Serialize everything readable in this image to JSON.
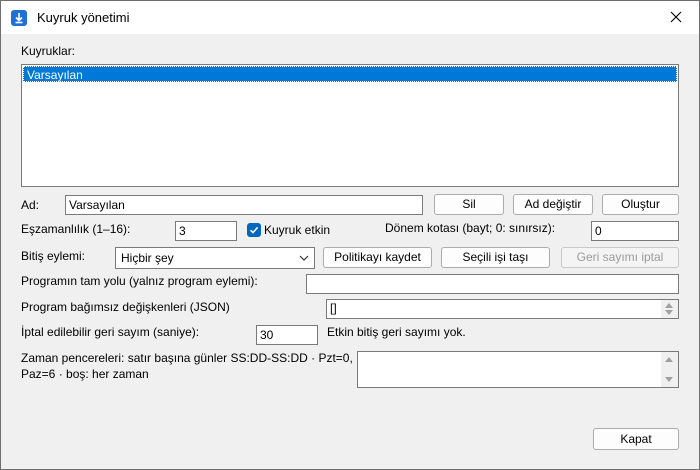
{
  "window": {
    "title": "Kuyruk yönetimi"
  },
  "queues": {
    "label": "Kuyruklar:",
    "items": [
      "Varsayılan"
    ]
  },
  "name": {
    "label": "Ad:",
    "value": "Varsayılan"
  },
  "buttons": {
    "delete": "Sil",
    "rename": "Ad değiştir",
    "create": "Oluştur",
    "save_policy": "Politikayı kaydet",
    "move_selected": "Seçili işi taşı",
    "cancel_countdown": "Geri sayımı iptal",
    "close": "Kapat"
  },
  "concurrency": {
    "label": "Eşzamanlılık (1–16):",
    "value": "3"
  },
  "queue_enabled": {
    "label": "Kuyruk etkin",
    "checked": true
  },
  "period_quota": {
    "label": "Dönem kotası (bayt; 0: sınırsız):",
    "value": "0"
  },
  "finish_action": {
    "label": "Bitiş eylemi:",
    "selected": "Hiçbir şey"
  },
  "program_path": {
    "label": "Programın tam yolu (yalnız program eylemi):",
    "value": ""
  },
  "program_env": {
    "label": "Program bağımsız değişkenleri (JSON)",
    "value": "[]"
  },
  "cancel_countdown_secs": {
    "label": "İptal edilebilir geri sayım (saniye):",
    "value": "30",
    "status": "Etkin bitiş geri sayımı yok."
  },
  "time_windows": {
    "label_line1": "Zaman pencereleri: satır başına günler SS:DD-SS:DD · Pzt=0,",
    "label_line2": "Paz=6 · boş: her zaman",
    "value": ""
  },
  "colors": {
    "selection": "#0078d7",
    "checkbox": "#0067c0"
  },
  "icons": {
    "app": "download-icon",
    "close": "close-icon",
    "dropdown": "chevron-down-icon"
  }
}
